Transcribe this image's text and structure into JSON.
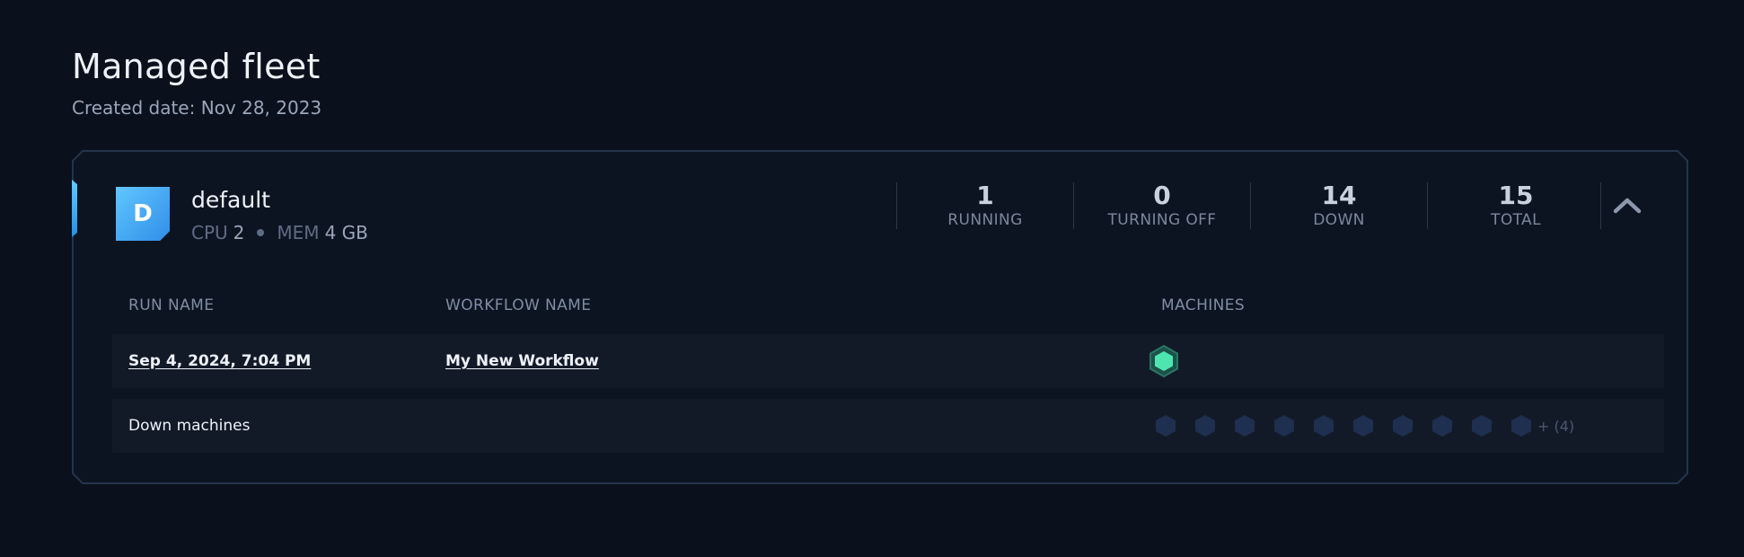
{
  "header": {
    "title": "Managed fleet",
    "created": "Created date: Nov 28, 2023"
  },
  "fleet": {
    "avatar_letter": "D",
    "name": "default",
    "cpu_label": "CPU",
    "cpu_value": "2",
    "mem_label": "MEM",
    "mem_value": "4 GB",
    "stats": [
      {
        "value": "1",
        "label": "RUNNING"
      },
      {
        "value": "0",
        "label": "TURNING OFF"
      },
      {
        "value": "14",
        "label": "DOWN"
      },
      {
        "value": "15",
        "label": "TOTAL"
      }
    ],
    "collapse_icon": "chevron-up-icon"
  },
  "table": {
    "columns": {
      "run_name": "RUN NAME",
      "workflow_name": "WORKFLOW NAME",
      "machines": "MACHINES"
    },
    "rows": [
      {
        "run_name": "Sep 4, 2024, 7:04 PM",
        "workflow_name": "My New Workflow",
        "running_machines": 1
      }
    ],
    "down_row": {
      "label": "Down machines",
      "shown_count": 10,
      "more_label": "+ (4)"
    }
  },
  "colors": {
    "background": "#0a101c",
    "card_border": "#24344c",
    "accent": "#3ea8f5",
    "running_machine": "#4ee6b0",
    "down_machine": "#1f2f4f"
  }
}
